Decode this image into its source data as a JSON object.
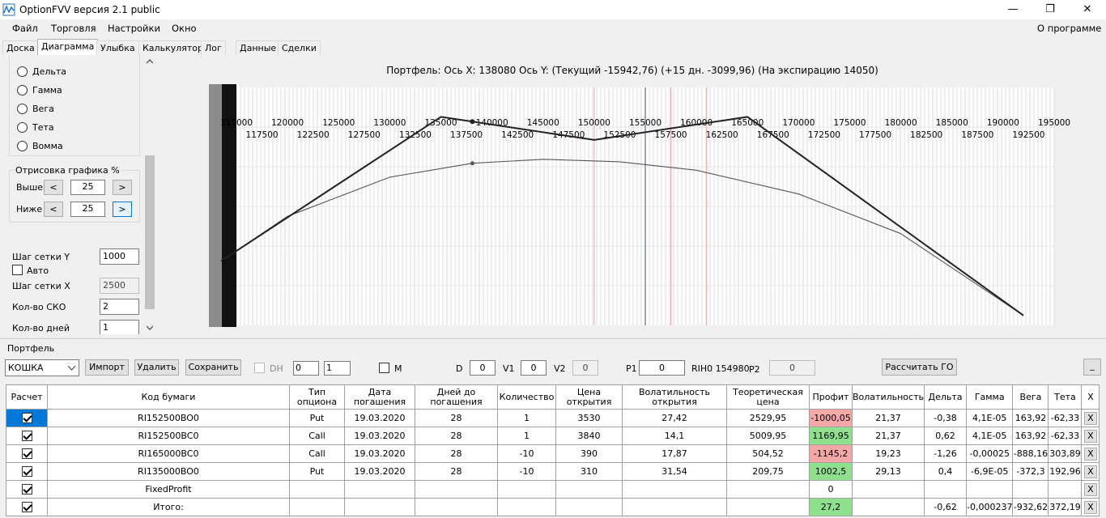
{
  "window": {
    "title": "OptionFVV версия 2.1 public",
    "minimize": "—",
    "maximize": "❐",
    "close": "✕"
  },
  "menu": {
    "items": [
      "Файл",
      "Торговля",
      "Настройки",
      "Окно"
    ],
    "about": "О программе"
  },
  "tabs": [
    "Доска",
    "Диаграмма",
    "Улыбка",
    "Калькулятор",
    "Лог",
    "Данные",
    "Сделки"
  ],
  "left": {
    "radios": [
      "Дельта",
      "Гамма",
      "Вега",
      "Тета",
      "Вомма"
    ],
    "render_group": "Отрисовка графика %",
    "above_label": "Выше",
    "above_value": "25",
    "below_label": "Ниже",
    "below_value": "25",
    "prev": "<",
    "next": ">",
    "grid_y_label": "Шаг сетки Y",
    "grid_y_value": "1000",
    "auto_label": "Авто",
    "grid_x_label": "Шаг сетки X",
    "grid_x_value": "2500",
    "sko_label": "Кол-во СКО",
    "sko_value": "2",
    "days_label": "Кол-во дней",
    "days_value": "1"
  },
  "chart": {
    "header": "Портфель: Ось X: 138080 Ось Y:  (Текущий -15942,76)  (+15 дн. -3099,96)  (На экспирацию 14050)"
  },
  "chart_data": {
    "type": "line",
    "xlim": [
      112500,
      195000
    ],
    "x_ticks_top": [
      "115000",
      "120000",
      "125000",
      "130000",
      "135000",
      "140000",
      "145000",
      "150000",
      "155000",
      "160000",
      "165000",
      "170000",
      "175000",
      "180000",
      "185000",
      "190000",
      "195000"
    ],
    "x_ticks_bottom": [
      "117500",
      "122500",
      "127500",
      "132500",
      "137500",
      "142500",
      "147500",
      "152500",
      "157500",
      "162500",
      "167500",
      "172500",
      "177500",
      "182500",
      "187500",
      "192500"
    ],
    "expiration_series": {
      "x": [
        113500,
        135000,
        150000,
        165000,
        192000
      ],
      "y": [
        -15000,
        14050,
        9400,
        14050,
        -26000
      ]
    },
    "plus15_series": {
      "x": [
        113500,
        120000,
        130000,
        138080,
        145000,
        152500,
        160000,
        170000,
        180000,
        192000
      ],
      "y": [
        -15000,
        -6000,
        1900,
        4700,
        5500,
        5000,
        3300,
        -1500,
        -9500,
        -26000
      ]
    },
    "marker_x": 138080,
    "current_price": 155000
  },
  "portfolio": {
    "group": "Портфель",
    "account": "КОШКА",
    "import": "Импорт",
    "delete": "Удалить",
    "save": "Сохранить",
    "dh": "DH",
    "dh_spin1": "0",
    "dh_spin2": "1",
    "m": "M",
    "d_label": "D",
    "d_value": "0",
    "v1_label": "V1",
    "v1_value": "0",
    "v2_label": "V2",
    "v2_value": "0",
    "p1_label": "P1",
    "p1_value": "0",
    "rih_text": "RIH0 154980",
    "p2_label": "P2",
    "p2_value": "0",
    "calc_go": "Рассчитать ГО",
    "minimize": "_"
  },
  "table": {
    "headers": [
      "Расчет",
      "Код бумаги",
      "Тип опциона",
      "Дата погашения",
      "Дней до погашения",
      "Количество",
      "Цена открытия",
      "Волатильность открытия",
      "Теоретическая цена",
      "Профит",
      "Волатильность",
      "Дельта",
      "Гамма",
      "Вега",
      "Тета",
      "X"
    ],
    "rows": [
      [
        "RI152500BO0",
        "Put",
        "19.03.2020",
        "28",
        "1",
        "3530",
        "27,42",
        "2529,95",
        "-1000,05",
        "21,37",
        "-0,38",
        "4,1E-05",
        "163,92",
        "-62,33"
      ],
      [
        "RI152500BC0",
        "Call",
        "19.03.2020",
        "28",
        "1",
        "3840",
        "14,1",
        "5009,95",
        "1169,95",
        "21,37",
        "0,62",
        "4,1E-05",
        "163,92",
        "-62,33"
      ],
      [
        "RI165000BC0",
        "Call",
        "19.03.2020",
        "28",
        "-10",
        "390",
        "17,87",
        "504,52",
        "-1145,2",
        "19,23",
        "-1,26",
        "-0,00025",
        "-888,16",
        "303,89"
      ],
      [
        "RI135000BO0",
        "Put",
        "19.03.2020",
        "28",
        "-10",
        "310",
        "31,54",
        "209,75",
        "1002,5",
        "29,13",
        "0,4",
        "-6,9E-05",
        "-372,3",
        "192,96"
      ]
    ],
    "fixed_label": "FixedProfit",
    "fixed_value": "0",
    "total_label": "Итого:",
    "total_profit": "27,2",
    "total_delta": "-0,62",
    "total_gamma": "-0,000237",
    "total_vega": "-932,62",
    "total_theta": "372,19",
    "x": "X",
    "profit_colors": {
      "negative": "#f4a7a7",
      "positive": "#8ee08e"
    }
  }
}
